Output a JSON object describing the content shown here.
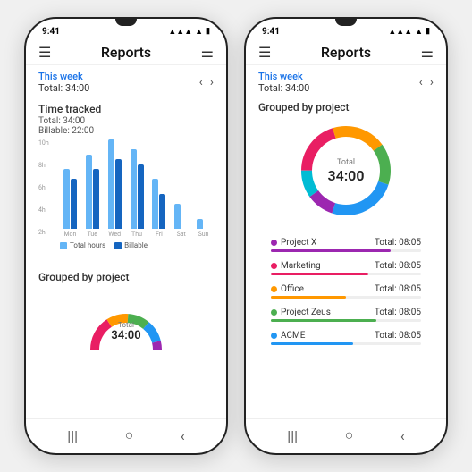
{
  "phones": [
    {
      "id": "left",
      "statusBar": {
        "time": "9:41"
      },
      "header": {
        "title": "Reports",
        "menuIcon": "☰",
        "filterIcon": "⚌"
      },
      "weekNav": {
        "weekLabel": "This week",
        "totalLabel": "Total: 34:00"
      },
      "chartSection": {
        "title": "Time tracked",
        "lines": [
          "Total: 34:00",
          "Billable: 22:00"
        ],
        "yLabels": [
          "10h",
          "8h",
          "6h",
          "4h",
          "2h"
        ],
        "days": [
          {
            "label": "Mon",
            "total": 60,
            "billable": 50
          },
          {
            "label": "Tue",
            "total": 75,
            "billable": 60
          },
          {
            "label": "Wed",
            "total": 90,
            "billable": 70
          },
          {
            "label": "Thu",
            "total": 80,
            "billable": 65
          },
          {
            "label": "Fri",
            "total": 50,
            "billable": 35
          },
          {
            "label": "Sat",
            "total": 25,
            "billable": 0
          },
          {
            "label": "Sun",
            "total": 10,
            "billable": 0
          }
        ],
        "legend": [
          {
            "label": "Total hours",
            "color": "#64b5f6"
          },
          {
            "label": "Billable",
            "color": "#1565c0"
          }
        ]
      },
      "groupedSection": {
        "title": "Grouped by project",
        "donut": {
          "totalLabel": "Total",
          "totalValue": "34:00",
          "segments": [
            {
              "color": "#e91e63",
              "percent": 20
            },
            {
              "color": "#ff9800",
              "percent": 20
            },
            {
              "color": "#4caf50",
              "percent": 15
            },
            {
              "color": "#2196f3",
              "percent": 25
            },
            {
              "color": "#9c27b0",
              "percent": 10
            },
            {
              "color": "#00bcd4",
              "percent": 10
            }
          ]
        }
      }
    },
    {
      "id": "right",
      "statusBar": {
        "time": "9:41"
      },
      "header": {
        "title": "Reports",
        "menuIcon": "☰",
        "filterIcon": "⚌"
      },
      "weekNav": {
        "weekLabel": "This week",
        "totalLabel": "Total: 34:00"
      },
      "groupedSection": {
        "title": "Grouped by project",
        "donut": {
          "totalLabel": "Total",
          "totalValue": "34:00",
          "segments": [
            {
              "color": "#e91e63",
              "percent": 20,
              "dash": 25.1,
              "offset": 0
            },
            {
              "color": "#ff9800",
              "percent": 20,
              "dash": 25.1,
              "offset": 25.1
            },
            {
              "color": "#4caf50",
              "percent": 15,
              "dash": 18.8,
              "offset": 50.2
            },
            {
              "color": "#2196f3",
              "percent": 25,
              "dash": 31.4,
              "offset": 69
            },
            {
              "color": "#9c27b0",
              "percent": 10,
              "dash": 12.6,
              "offset": 100.4
            },
            {
              "color": "#00bcd4",
              "percent": 10,
              "dash": 12.6,
              "offset": 113
            }
          ]
        },
        "projects": [
          {
            "name": "Project X",
            "color": "#9c27b0",
            "total": "08:05",
            "barColor": "#9c27b0",
            "barWidth": "80%"
          },
          {
            "name": "Marketing",
            "color": "#e91e63",
            "total": "08:05",
            "barColor": "#e91e63",
            "barWidth": "65%"
          },
          {
            "name": "Office",
            "color": "#ff9800",
            "total": "08:05",
            "barColor": "#ff9800",
            "barWidth": "50%"
          },
          {
            "name": "Project Zeus",
            "color": "#4caf50",
            "total": "08:05",
            "barColor": "#4caf50",
            "barWidth": "70%"
          },
          {
            "name": "ACME",
            "color": "#2196f3",
            "total": "08:05",
            "barColor": "#2196f3",
            "barWidth": "55%"
          }
        ]
      }
    }
  ],
  "bottomNav": {
    "icons": [
      "|||",
      "○",
      "<"
    ]
  }
}
